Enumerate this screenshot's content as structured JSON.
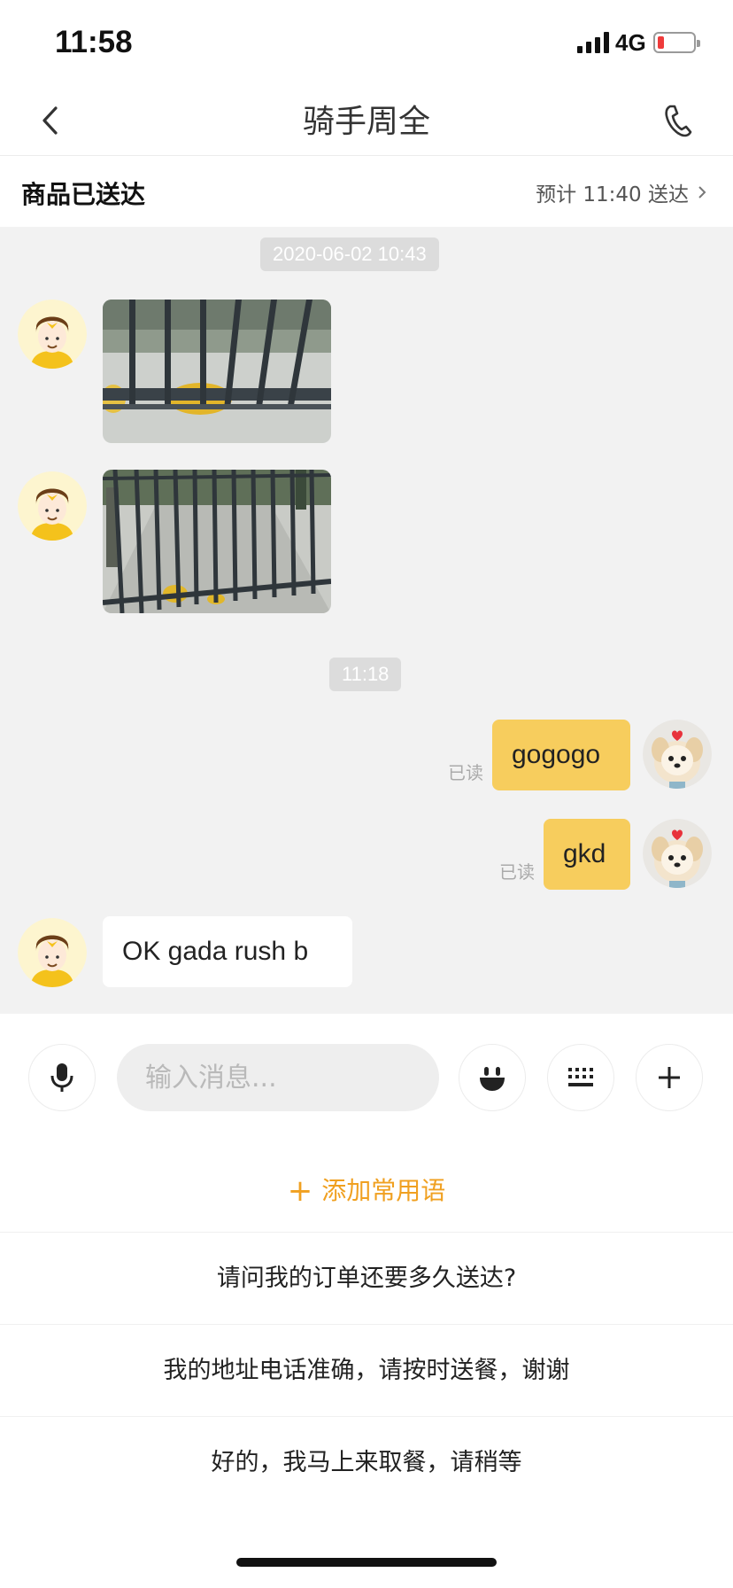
{
  "status_bar": {
    "time": "11:58",
    "network": "4G"
  },
  "nav": {
    "title": "骑手周全"
  },
  "order": {
    "status": "商品已送达",
    "eta": "预计 11:40 送达"
  },
  "chat": {
    "timestamps": [
      "2020-06-02 10:43",
      "11:18"
    ],
    "read_label": "已读",
    "outgoing": [
      "gogogo",
      "gkd"
    ],
    "incoming_text": "OK gada  rush b"
  },
  "input": {
    "placeholder": "输入消息..."
  },
  "quick_phrases": {
    "add_label": "添加常用语",
    "items": [
      "请问我的订单还要多久送达?",
      "我的地址电话准确，请按时送餐，谢谢",
      "好的，我马上来取餐，请稍等"
    ]
  },
  "colors": {
    "accent": "#f7cd5d",
    "rider_yellow": "#f4c21c",
    "add_phrase": "#f0a020",
    "chat_bg": "#f2f2f2"
  },
  "icons": [
    "back-icon",
    "phone-icon",
    "microphone-icon",
    "emoji-icon",
    "keyboard-icon",
    "plus-icon",
    "chevron-right-icon"
  ]
}
